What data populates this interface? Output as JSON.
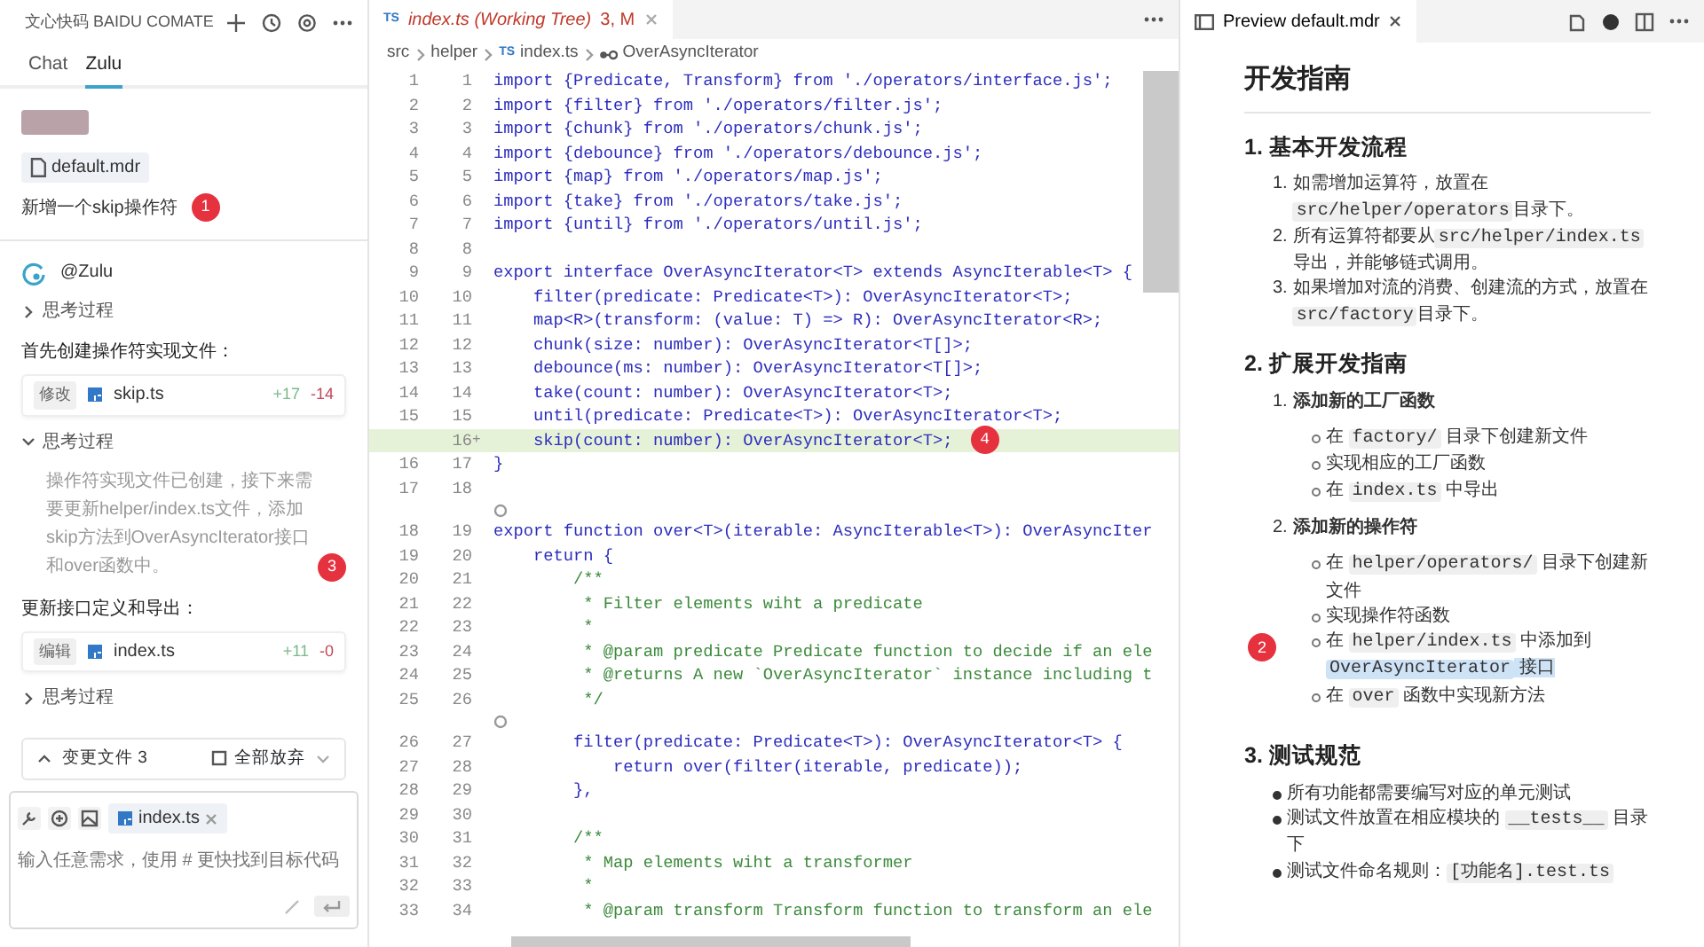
{
  "assistant_panel": {
    "title": "文心快码 BAIDU COMATE",
    "tabs": [
      {
        "label": "Chat",
        "selected": false
      },
      {
        "label": "Zulu",
        "selected": true
      }
    ],
    "user_message": {
      "attachment": "default.mdr",
      "text": "新增一个skip操作符",
      "badge": "1"
    },
    "reply": {
      "author": "@Zulu",
      "items": [
        {
          "kind": "thinking",
          "label": "思考过程",
          "expanded": false
        },
        {
          "kind": "text",
          "text": "首先创建操作符实现文件："
        },
        {
          "kind": "file_change",
          "action": "修改",
          "file": "skip.ts",
          "added": "+17",
          "removed": "-14"
        },
        {
          "kind": "thinking",
          "label": "思考过程",
          "expanded": true,
          "text": "操作符实现文件已创建，接下来需要更新helper/index.ts文件，添加skip方法到OverAsyncIterator接口和over函数中。",
          "badge": "3"
        },
        {
          "kind": "text",
          "text": "更新接口定义和导出："
        },
        {
          "kind": "file_change",
          "action": "编辑",
          "file": "index.ts",
          "added": "+11",
          "removed": "-0"
        },
        {
          "kind": "thinking",
          "label": "思考过程",
          "expanded": false
        }
      ]
    },
    "changes_bar": {
      "label": "变更文件 3",
      "discard": "全部放弃"
    },
    "composer": {
      "context_file": "index.ts",
      "placeholder": "输入任意需求，使用 # 更快找到目标代码"
    }
  },
  "editor": {
    "tab": {
      "icon_text": "TS",
      "title": "index.ts (Working Tree)",
      "status": "3, M"
    },
    "breadcrumb": [
      {
        "text": "src"
      },
      {
        "text": "helper"
      },
      {
        "icon_text": "TS",
        "text": "index.ts"
      },
      {
        "text": "OverAsyncIterator"
      }
    ],
    "lines": [
      {
        "kind": "code",
        "old": "1",
        "new": "1",
        "text": "import {Predicate, Transform} from './operators/interface.js';"
      },
      {
        "kind": "code",
        "old": "2",
        "new": "2",
        "text": "import {filter} from './operators/filter.js';"
      },
      {
        "kind": "code",
        "old": "3",
        "new": "3",
        "text": "import {chunk} from './operators/chunk.js';"
      },
      {
        "kind": "code",
        "old": "4",
        "new": "4",
        "text": "import {debounce} from './operators/debounce.js';"
      },
      {
        "kind": "code",
        "old": "5",
        "new": "5",
        "text": "import {map} from './operators/map.js';"
      },
      {
        "kind": "code",
        "old": "6",
        "new": "6",
        "text": "import {take} from './operators/take.js';"
      },
      {
        "kind": "code",
        "old": "7",
        "new": "7",
        "text": "import {until} from './operators/until.js';"
      },
      {
        "kind": "code",
        "old": "8",
        "new": "8"
      },
      {
        "kind": "code",
        "old": "9",
        "new": "9",
        "text": "export interface OverAsyncIterator<T> extends AsyncIterable<T> {"
      },
      {
        "kind": "code",
        "old": "10",
        "new": "10",
        "text": "    filter(predicate: Predicate<T>): OverAsyncIterator<T>;"
      },
      {
        "kind": "code",
        "old": "11",
        "new": "11",
        "text": "    map<R>(transform: (value: T) => R): OverAsyncIterator<R>;"
      },
      {
        "kind": "code",
        "old": "12",
        "new": "12",
        "text": "    chunk(size: number): OverAsyncIterator<T[]>;"
      },
      {
        "kind": "code",
        "old": "13",
        "new": "13",
        "text": "    debounce(ms: number): OverAsyncIterator<T[]>;"
      },
      {
        "kind": "code",
        "old": "14",
        "new": "14",
        "text": "    take(count: number): OverAsyncIterator<T>;"
      },
      {
        "kind": "code",
        "old": "15",
        "new": "15",
        "text": "    until(predicate: Predicate<T>): OverAsyncIterator<T>;"
      },
      {
        "kind": "added",
        "new": "16",
        "mark": "+",
        "text": "    skip(count: number): OverAsyncIterator<T>;",
        "badge": "4"
      },
      {
        "kind": "code",
        "old": "16",
        "new": "17",
        "text": "}"
      },
      {
        "kind": "code",
        "old": "17",
        "new": "18"
      },
      {
        "kind": "codelens"
      },
      {
        "kind": "code",
        "old": "18",
        "new": "19",
        "text": "export function over<T>(iterable: AsyncIterable<T>): OverAsyncIter"
      },
      {
        "kind": "code",
        "old": "19",
        "new": "20",
        "text": "    return {"
      },
      {
        "kind": "comment",
        "old": "20",
        "new": "21",
        "text": "        /**"
      },
      {
        "kind": "comment",
        "old": "21",
        "new": "22",
        "text": "         * Filter elements wiht a predicate"
      },
      {
        "kind": "comment",
        "old": "22",
        "new": "23",
        "text": "         *"
      },
      {
        "kind": "comment",
        "old": "23",
        "new": "24",
        "text": "         * @param predicate Predicate function to decide if an ele"
      },
      {
        "kind": "comment",
        "old": "24",
        "new": "25",
        "text": "         * @returns A new `OverAsyncIterator` instance including t"
      },
      {
        "kind": "comment",
        "old": "25",
        "new": "26",
        "text": "         */"
      },
      {
        "kind": "codelens"
      },
      {
        "kind": "code",
        "old": "26",
        "new": "27",
        "text": "        filter(predicate: Predicate<T>): OverAsyncIterator<T> {"
      },
      {
        "kind": "code",
        "old": "27",
        "new": "28",
        "text": "            return over(filter(iterable, predicate));"
      },
      {
        "kind": "code",
        "old": "28",
        "new": "29",
        "text": "        },"
      },
      {
        "kind": "code",
        "old": "29",
        "new": "30"
      },
      {
        "kind": "comment",
        "old": "30",
        "new": "31",
        "text": "        /**"
      },
      {
        "kind": "comment",
        "old": "31",
        "new": "32",
        "text": "         * Map elements wiht a transformer"
      },
      {
        "kind": "comment",
        "old": "32",
        "new": "33",
        "text": "         *"
      },
      {
        "kind": "comment",
        "old": "33",
        "new": "34",
        "text": "         * @param transform Transform function to transform an ele"
      }
    ]
  },
  "preview": {
    "tab": "Preview default.mdr",
    "blocks": [
      {
        "kind": "h1",
        "text": "开发指南"
      },
      {
        "kind": "h2",
        "text": "1. 基本开发流程"
      },
      {
        "kind": "ol",
        "items": [
          {
            "number": "1.",
            "segments": [
              {
                "kind": "text",
                "text": "如需增加运算符，放置在",
                "selected": false
              },
              {
                "kind": "code",
                "text": "src/helper/operators",
                "selected": false
              },
              {
                "kind": "text",
                "text": "目录下。",
                "selected": false
              }
            ]
          },
          {
            "number": "2.",
            "segments": [
              {
                "kind": "text",
                "text": "所有运算符都要从",
                "selected": false
              },
              {
                "kind": "code",
                "text": "src/helper/index.ts",
                "selected": false
              },
              {
                "kind": "text",
                "text": "导出，并能够链式调用。",
                "selected": false
              }
            ]
          },
          {
            "number": "3.",
            "segments": [
              {
                "kind": "text",
                "text": "如果增加对流的消费、创建流的方式，放置在",
                "selected": false
              },
              {
                "kind": "code",
                "text": "src/factory",
                "selected": false
              },
              {
                "kind": "text",
                "text": "目录下。",
                "selected": false
              }
            ]
          }
        ]
      },
      {
        "kind": "h2",
        "text": "2. 扩展开发指南"
      },
      {
        "kind": "ol",
        "items": [
          {
            "number": "1.",
            "segments": [
              {
                "kind": "text",
                "text": "添加新的工厂函数",
                "selected": false
              }
            ],
            "children": [
              {
                "segments": [
                  {
                    "kind": "text",
                    "text": "在 ",
                    "selected": false
                  },
                  {
                    "kind": "code",
                    "text": "factory/",
                    "selected": false
                  },
                  {
                    "kind": "text",
                    "text": " 目录下创建新文件",
                    "selected": false
                  }
                ]
              },
              {
                "segments": [
                  {
                    "kind": "text",
                    "text": "实现相应的工厂函数",
                    "selected": false
                  }
                ]
              },
              {
                "segments": [
                  {
                    "kind": "text",
                    "text": "在 ",
                    "selected": false
                  },
                  {
                    "kind": "code",
                    "text": "index.ts",
                    "selected": false
                  },
                  {
                    "kind": "text",
                    "text": " 中导出",
                    "selected": false
                  }
                ]
              }
            ]
          },
          {
            "number": "2.",
            "segments": [
              {
                "kind": "text",
                "text": "添加新的操作符",
                "selected": false
              }
            ],
            "children": [
              {
                "segments": [
                  {
                    "kind": "text",
                    "text": "在 ",
                    "selected": false
                  },
                  {
                    "kind": "code",
                    "text": "helper/operators/",
                    "selected": false
                  },
                  {
                    "kind": "text",
                    "text": " 目录下创建新文件",
                    "selected": false
                  }
                ]
              },
              {
                "segments": [
                  {
                    "kind": "text",
                    "text": "实现操作符函数",
                    "selected": false
                  }
                ]
              },
              {
                "badge": "2",
                "segments": [
                  {
                    "kind": "text",
                    "text": "在 ",
                    "selected": false
                  },
                  {
                    "kind": "code",
                    "text": "helper/index.ts",
                    "selected": false
                  },
                  {
                    "kind": "text",
                    "text": " 中添加到",
                    "selected": false
                  },
                  {
                    "kind": "code",
                    "text": "OverAsyncIterator",
                    "selected": true
                  },
                  {
                    "kind": "text",
                    "text": " 接口",
                    "selected": true
                  }
                ]
              },
              {
                "segments": [
                  {
                    "kind": "text",
                    "text": "在 ",
                    "selected": false
                  },
                  {
                    "kind": "code",
                    "text": "over",
                    "selected": false
                  },
                  {
                    "kind": "text",
                    "text": " 函数中实现新方法",
                    "selected": false
                  }
                ]
              }
            ]
          }
        ]
      },
      {
        "kind": "h2",
        "text": "3. 测试规范"
      },
      {
        "kind": "ul",
        "items": [
          {
            "segments": [
              {
                "kind": "text",
                "text": "所有功能都需要编写对应的单元测试",
                "selected": false
              }
            ]
          },
          {
            "segments": [
              {
                "kind": "text",
                "text": "测试文件放置在相应模块的 ",
                "selected": false
              },
              {
                "kind": "code",
                "text": "__tests__",
                "selected": false
              },
              {
                "kind": "text",
                "text": " 目录下",
                "selected": false
              }
            ]
          },
          {
            "segments": [
              {
                "kind": "text",
                "text": "测试文件命名规则：",
                "selected": false
              },
              {
                "kind": "code",
                "text": "[功能名].test.ts",
                "selected": false
              }
            ]
          }
        ]
      }
    ]
  }
}
